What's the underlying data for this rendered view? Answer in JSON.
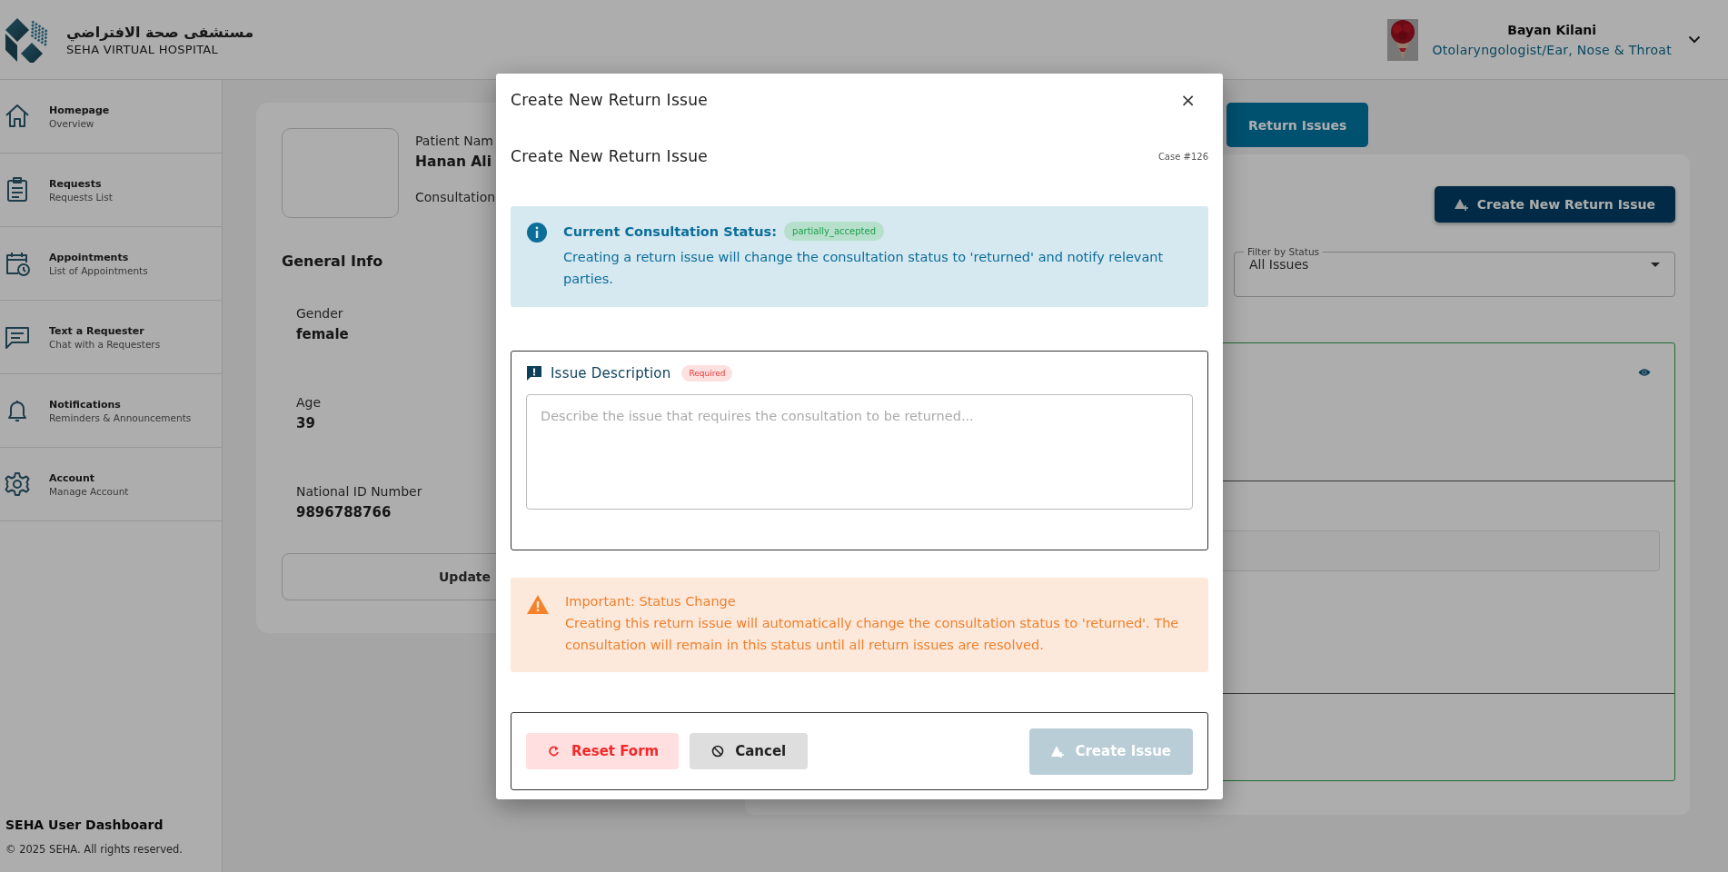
{
  "header": {
    "logo_arabic": "مستشفى صحة الافتراضي",
    "logo_english": "SEHA VIRTUAL HOSPITAL",
    "user": {
      "name": "Bayan Kilani",
      "role": "Otolaryngologist/Ear, Nose & Throat"
    }
  },
  "sidebar": {
    "items": [
      {
        "title": "Homepage",
        "subtitle": "Overview"
      },
      {
        "title": "Requests",
        "subtitle": "Requests List"
      },
      {
        "title": "Appointments",
        "subtitle": "List of Appointments"
      },
      {
        "title": "Text a Requester",
        "subtitle": "Chat with a Requesters"
      },
      {
        "title": "Notifications",
        "subtitle": "Reminders & Announcements"
      },
      {
        "title": "Account",
        "subtitle": "Manage Account"
      }
    ],
    "footer": {
      "title": "SEHA User Dashboard",
      "copyright": "© 2025 SEHA. All rights reserved."
    }
  },
  "patient_card": {
    "name_label": "Patient Nam",
    "name": "Hanan Ali",
    "consultation_label": "Consultation",
    "section_title": "General Info",
    "fields": [
      {
        "label": "Gender",
        "value": "female"
      },
      {
        "label": "Age",
        "value": "39"
      },
      {
        "label": "National ID Number",
        "value": "9896788766"
      }
    ],
    "button": "Update"
  },
  "tabs": [
    {
      "label": "Return Issues",
      "selected": true
    }
  ],
  "issues_panel": {
    "create_button": "Create New Return Issue",
    "filter": {
      "label": "Filter by Status",
      "value": "All Issues"
    }
  },
  "modal": {
    "title": "Create New Return Issue",
    "close": "×",
    "heading": "Create New Return Issue",
    "case": "Case #126",
    "status": {
      "label": "Current Consultation Status:",
      "value": "partially_accepted"
    },
    "info_text": "Creating a return issue will change the consultation status to 'returned' and notify relevant parties.",
    "description": {
      "label": "Issue Description",
      "badge": "Required",
      "placeholder": "Describe the issue that requires the consultation to be returned..."
    },
    "warning": {
      "title": "Important: Status Change",
      "text": "Creating this return issue will automatically change the consultation status to 'returned'. The consultation will remain in this status until all return issues are resolved."
    },
    "buttons": [
      {
        "label": "Reset Form",
        "kind": "reset"
      },
      {
        "label": "Cancel",
        "kind": "cancel"
      },
      {
        "label": "Create Issue",
        "kind": "create",
        "disabled": true
      }
    ]
  }
}
